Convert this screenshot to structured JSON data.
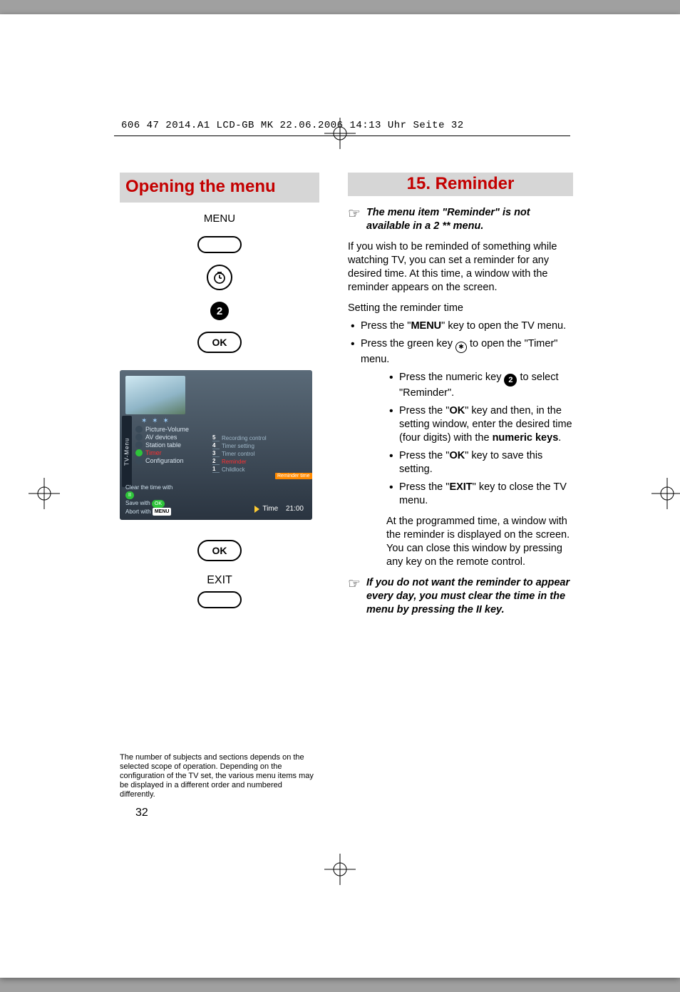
{
  "slug": "606 47 2014.A1 LCD-GB MK  22.06.2006  14:13 Uhr  Seite 32",
  "left": {
    "title": "Opening the menu",
    "menu_label": "MENU",
    "badge_number": "2",
    "ok_label": "OK",
    "ok2_label": "OK",
    "exit_label": "EXIT"
  },
  "osd": {
    "leftbar": "TV-Menu",
    "stars": "✶ ✶ ✶",
    "items": [
      {
        "label": "Picture-Volume"
      },
      {
        "label": "AV devices"
      },
      {
        "label": "Station table"
      },
      {
        "label": "Timer",
        "active": true
      },
      {
        "label": "Configuration"
      }
    ],
    "sub": [
      {
        "n": "5",
        "label": "Recording control"
      },
      {
        "n": "4",
        "label": "Timer setting"
      },
      {
        "n": "3",
        "label": "Timer control"
      },
      {
        "n": "2",
        "label": "Reminder",
        "active": true
      },
      {
        "n": "1",
        "label": "Childlock"
      }
    ],
    "chip": "Reminder time",
    "notes": {
      "line1a": "Clear the time with",
      "line1b": "II",
      "line2a": "Save with",
      "line2b": "OK",
      "line3a": "Abort with",
      "line3b": "MENU"
    },
    "time_label": "Time",
    "time_value": "21:00"
  },
  "right": {
    "title": "15. Reminder",
    "note1": "The menu item \"Reminder\" is not available in a 2 ** menu.",
    "para1": "If you wish to be reminded of something while watching TV, you can set a reminder for any desired time. At this time, a window with the reminder appears on the screen.",
    "subhead": "Setting the reminder time",
    "b1a": "Press the \"",
    "b1b": "MENU",
    "b1c": "\" key to open the TV menu.",
    "b2a": "Press the green key ",
    "b2b": " to open the \"Timer\" menu.",
    "b3a": "Press the numeric key ",
    "b3_badge": "2",
    "b3b": " to select \"Reminder\".",
    "b4a": "Press the \"",
    "b4b": "OK",
    "b4c": "\" key and then, in the setting window, enter the desired time (four digits) with the ",
    "b4d": "numeric keys",
    "b4e": ".",
    "b5a": "Press the \"",
    "b5b": "OK",
    "b5c": "\" key to save this setting.",
    "b6a": "Press the \"",
    "b6b": "EXIT",
    "b6c": "\" key to close the TV menu.",
    "para2": "At the programmed time, a window with the reminder is displayed on the screen. You can close this window by pressing any key on the remote control.",
    "note2": "If you do not want the reminder to appear every day, you must clear the time in the menu by pressing the II key."
  },
  "footnote": "The number of subjects and sections depends on the selected scope of operation. Depending on the configuration of the TV set, the various menu items may be displayed in a different order and numbered differently.",
  "pagenum": "32"
}
